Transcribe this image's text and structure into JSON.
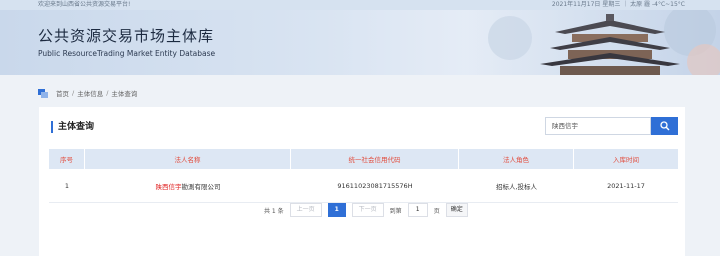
{
  "topbar": {
    "welcome": "欢迎来到山西省公共资源交易平台!",
    "date_weather": "2021年11月17日 星期三 ｜ 太原 霾 -4°C~15°C"
  },
  "banner": {
    "title_cn": "公共资源交易市场主体库",
    "title_en": "Public ResourceTrading Market Entity Database"
  },
  "breadcrumb": [
    "首页",
    "主体信息",
    "主体查询"
  ],
  "breadcrumb_sep": "/",
  "card": {
    "title": "主体查询",
    "search_value": "陕西信宇"
  },
  "table": {
    "headers": [
      "序号",
      "法人名称",
      "统一社会信用代码",
      "法人角色",
      "入库时间"
    ],
    "rows": [
      {
        "index": "1",
        "name_highlight": "陕西信宇",
        "name_rest": "勘測有限公司",
        "credit_code": "91611023081715576H",
        "role": "招标人,投标人",
        "date": "2021-11-17"
      }
    ]
  },
  "pager": {
    "total": "共 1 条",
    "prev": "上一页",
    "current": "1",
    "next": "下一页",
    "goto_label": "到第",
    "goto_value": "1",
    "page_unit": "页",
    "confirm": "确定"
  },
  "colors": {
    "accent": "#2f6fd6",
    "header_bg": "#dde7f4",
    "header_text": "#e24a3a",
    "highlight": "#e02020"
  }
}
